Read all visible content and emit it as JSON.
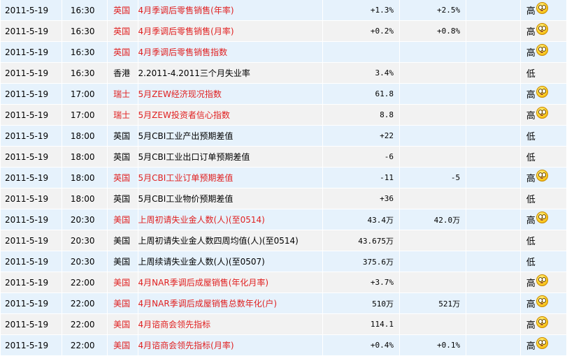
{
  "rows": [
    {
      "date": "2011-5-19",
      "time": "16:30",
      "country": "英国",
      "event": "4月季调后零售销售(年率)",
      "previous": "+1.3%",
      "forecast": "+2.5%",
      "actual": "",
      "importance": "高",
      "high": true,
      "icon": "surprised-face-icon"
    },
    {
      "date": "2011-5-19",
      "time": "16:30",
      "country": "英国",
      "event": "4月季调后零售销售(月率)",
      "previous": "+0.2%",
      "forecast": "+0.8%",
      "actual": "",
      "importance": "高",
      "high": true,
      "icon": "surprised-face-icon"
    },
    {
      "date": "2011-5-19",
      "time": "16:30",
      "country": "英国",
      "event": "4月季调后零售销售指数",
      "previous": "",
      "forecast": "",
      "actual": "",
      "importance": "高",
      "high": true,
      "icon": "surprised-face-icon"
    },
    {
      "date": "2011-5-19",
      "time": "16:30",
      "country": "香港",
      "event": "2.2011-4.2011三个月失业率",
      "previous": "3.4%",
      "forecast": "",
      "actual": "",
      "importance": "低",
      "high": false
    },
    {
      "date": "2011-5-19",
      "time": "17:00",
      "country": "瑞士",
      "event": "5月ZEW经济现况指数",
      "previous": "61.8",
      "forecast": "",
      "actual": "",
      "importance": "高",
      "high": true,
      "icon": "surprised-face-icon"
    },
    {
      "date": "2011-5-19",
      "time": "17:00",
      "country": "瑞士",
      "event": "5月ZEW投资者信心指数",
      "previous": "8.8",
      "forecast": "",
      "actual": "",
      "importance": "高",
      "high": true,
      "icon": "surprised-face-icon"
    },
    {
      "date": "2011-5-19",
      "time": "18:00",
      "country": "英国",
      "event": "5月CBI工业产出预期差值",
      "previous": "+22",
      "forecast": "",
      "actual": "",
      "importance": "低",
      "high": false
    },
    {
      "date": "2011-5-19",
      "time": "18:00",
      "country": "英国",
      "event": "5月CBI工业出口订单预期差值",
      "previous": "-6",
      "forecast": "",
      "actual": "",
      "importance": "低",
      "high": false
    },
    {
      "date": "2011-5-19",
      "time": "18:00",
      "country": "英国",
      "event": "5月CBI工业订单预期差值",
      "previous": "-11",
      "forecast": "-5",
      "actual": "",
      "importance": "高",
      "high": true,
      "icon": "surprised-face-icon"
    },
    {
      "date": "2011-5-19",
      "time": "18:00",
      "country": "英国",
      "event": "5月CBI工业物价预期差值",
      "previous": "+36",
      "forecast": "",
      "actual": "",
      "importance": "低",
      "high": false
    },
    {
      "date": "2011-5-19",
      "time": "20:30",
      "country": "美国",
      "event": "上周初请失业金人数(人)(至0514)",
      "previous": "43.4万",
      "forecast": "42.0万",
      "actual": "",
      "importance": "高",
      "high": true,
      "icon": "surprised-face-icon"
    },
    {
      "date": "2011-5-19",
      "time": "20:30",
      "country": "美国",
      "event": "上周初请失业金人数四周均值(人)(至0514)",
      "previous": "43.675万",
      "forecast": "",
      "actual": "",
      "importance": "低",
      "high": false
    },
    {
      "date": "2011-5-19",
      "time": "20:30",
      "country": "美国",
      "event": "上周续请失业金人数(人)(至0507)",
      "previous": "375.6万",
      "forecast": "",
      "actual": "",
      "importance": "低",
      "high": false
    },
    {
      "date": "2011-5-19",
      "time": "22:00",
      "country": "美国",
      "event": "4月NAR季调后成屋销售(年化月率)",
      "previous": "+3.7%",
      "forecast": "",
      "actual": "",
      "importance": "高",
      "high": true,
      "icon": "surprised-face-icon"
    },
    {
      "date": "2011-5-19",
      "time": "22:00",
      "country": "美国",
      "event": "4月NAR季调后成屋销售总数年化(户)",
      "previous": "510万",
      "forecast": "521万",
      "actual": "",
      "importance": "高",
      "high": true,
      "icon": "surprised-face-icon"
    },
    {
      "date": "2011-5-19",
      "time": "22:00",
      "country": "美国",
      "event": "4月谘商会领先指标",
      "previous": "114.1",
      "forecast": "",
      "actual": "",
      "importance": "高",
      "high": true,
      "icon": "surprised-face-icon"
    },
    {
      "date": "2011-5-19",
      "time": "22:00",
      "country": "美国",
      "event": "4月谘商会领先指标(月率)",
      "previous": "+0.4%",
      "forecast": "+0.1%",
      "actual": "",
      "importance": "高",
      "high": true,
      "icon": "surprised-face-icon"
    }
  ]
}
